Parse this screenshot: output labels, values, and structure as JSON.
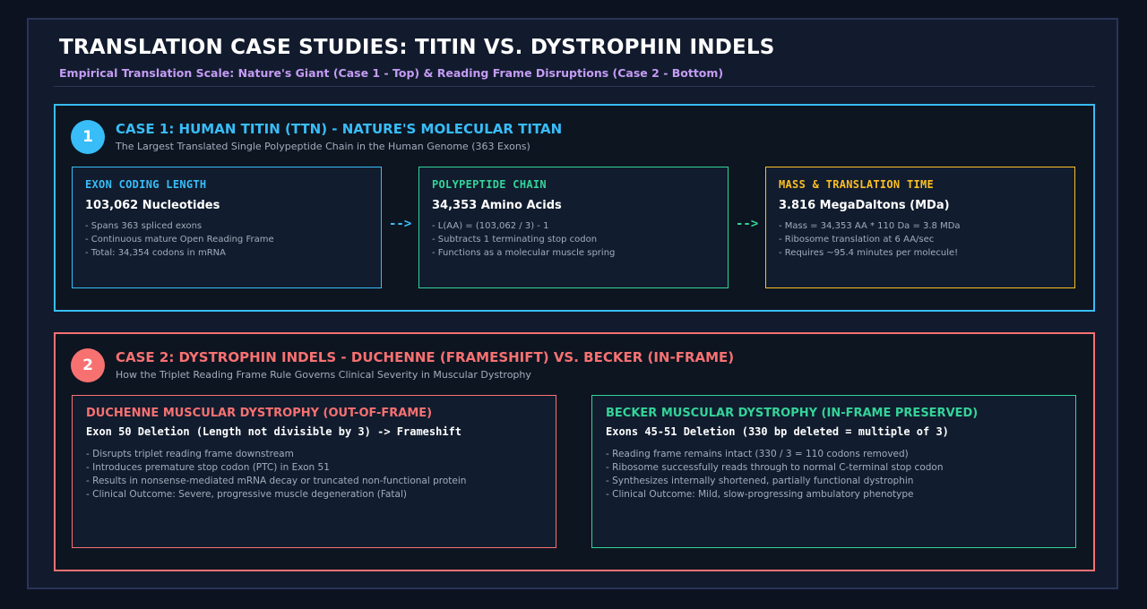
{
  "header": {
    "title": "TRANSLATION CASE STUDIES: TITIN VS. DYSTROPHIN INDELS",
    "subtitle": "Empirical Translation Scale: Nature's Giant (Case 1 - Top) & Reading Frame Disruptions (Case 2 - Bottom)"
  },
  "case1": {
    "number": "1",
    "title": "CASE 1: HUMAN TITIN (TTN) - NATURE'S MOLECULAR TITAN",
    "subtitle": "The Largest Translated Single Polypeptide Chain in the Human Genome (363 Exons)",
    "arrow_label": "-->",
    "cards": [
      {
        "title": "EXON CODING LENGTH",
        "value": "103,062 Nucleotides",
        "color": "#38bdf8",
        "lines": [
          "- Spans 363 spliced exons",
          "- Continuous mature Open Reading Frame",
          "- Total: 34,354 codons in mRNA"
        ]
      },
      {
        "title": "POLYPEPTIDE CHAIN",
        "value": "34,353 Amino Acids",
        "color": "#34d399",
        "lines": [
          "- L(AA) = (103,062 / 3) - 1",
          "- Subtracts 1 terminating stop codon",
          "- Functions as a molecular muscle spring"
        ]
      },
      {
        "title": "MASS & TRANSLATION TIME",
        "value": "3.816 MegaDaltons (MDa)",
        "color": "#fbbf24",
        "lines": [
          "- Mass = 34,353 AA * 110 Da = 3.8 MDa",
          "- Ribosome translation at 6 AA/sec",
          "- Requires ~95.4 minutes per molecule!"
        ]
      }
    ]
  },
  "case2": {
    "number": "2",
    "title": "CASE 2: DYSTROPHIN INDELS - DUCHENNE (FRAMESHIFT) VS. BECKER (IN-FRAME)",
    "subtitle": "How the Triplet Reading Frame Rule Governs Clinical Severity in Muscular Dystrophy",
    "cards": [
      {
        "title": "DUCHENNE MUSCULAR DYSTROPHY (OUT-OF-FRAME)",
        "value": "Exon 50 Deletion (Length not divisible by 3) -> Frameshift",
        "color": "#f87171",
        "lines": [
          "- Disrupts triplet reading frame downstream",
          "- Introduces premature stop codon (PTC) in Exon 51",
          "- Results in nonsense-mediated mRNA decay or truncated non-functional protein",
          "- Clinical Outcome: Severe, progressive muscle degeneration (Fatal)"
        ]
      },
      {
        "title": "BECKER MUSCULAR DYSTROPHY (IN-FRAME PRESERVED)",
        "value": "Exons 45-51 Deletion (330 bp deleted = multiple of 3)",
        "color": "#34d399",
        "lines": [
          "- Reading frame remains intact (330 / 3 = 110 codons removed)",
          "- Ribosome successfully reads through to normal C-terminal stop codon",
          "- Synthesizes internally shortened, partially functional dystrophin",
          "- Clinical Outcome: Mild, slow-progressing ambulatory phenotype"
        ]
      }
    ]
  }
}
